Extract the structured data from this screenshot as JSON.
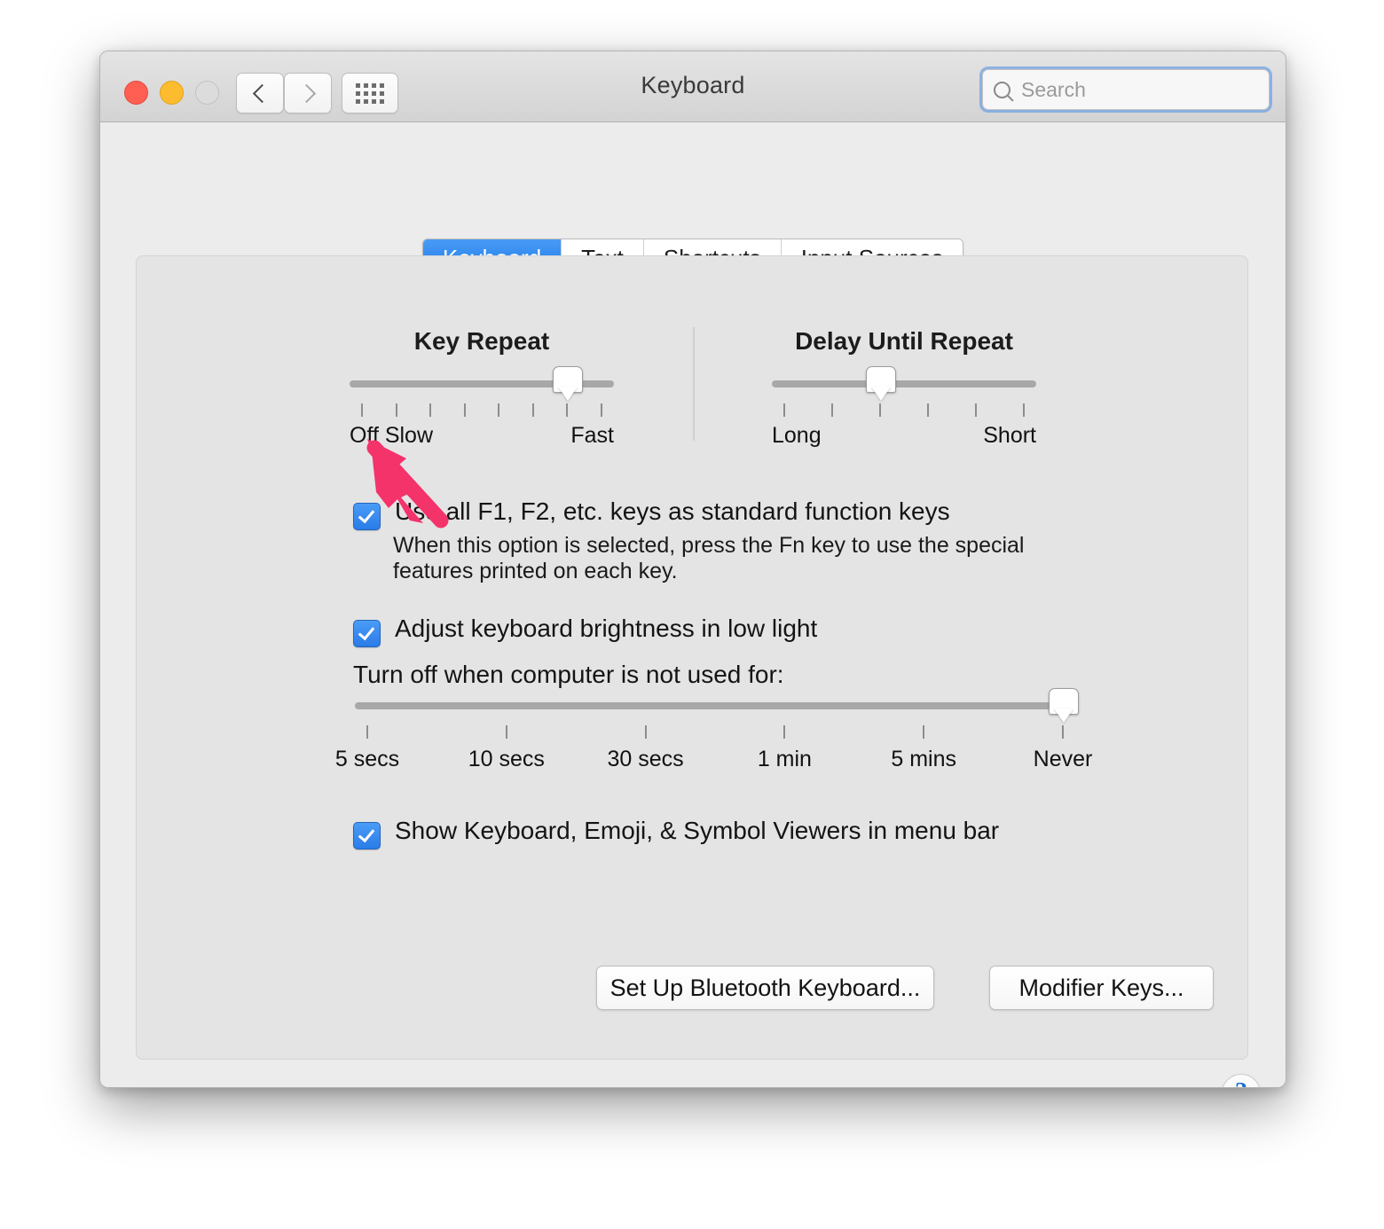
{
  "window": {
    "title": "Keyboard",
    "traffic_lights": {
      "close_label": "close",
      "minimize_label": "minimize",
      "zoom_label": "zoom"
    },
    "nav": {
      "back_icon": "chevron-left-icon",
      "forward_icon": "chevron-right-icon",
      "grid_icon": "show-all-grid-icon"
    }
  },
  "search": {
    "placeholder": "Search",
    "value": "",
    "icon": "search-icon"
  },
  "tabs": [
    {
      "label": "Keyboard",
      "active": true
    },
    {
      "label": "Text",
      "active": false
    },
    {
      "label": "Shortcuts",
      "active": false
    },
    {
      "label": "Input Sources",
      "active": false
    }
  ],
  "sliders": {
    "key_repeat": {
      "title": "Key Repeat",
      "left_label": "Off Slow",
      "right_label": "Fast",
      "tick_count": 8,
      "value_index": 6
    },
    "delay_until_repeat": {
      "title": "Delay Until Repeat",
      "left_label": "Long",
      "right_label": "Short",
      "tick_count": 6,
      "value_index": 2
    },
    "turn_off_after": {
      "label": "Turn off when computer is not used for:",
      "tick_labels": [
        "5 secs",
        "10 secs",
        "30 secs",
        "1 min",
        "5 mins",
        "Never"
      ],
      "value": "Never",
      "value_index": 5
    }
  },
  "checkboxes": {
    "function_keys": {
      "label": "Use all F1, F2, etc. keys as standard function keys",
      "checked": true,
      "description": "When this option is selected, press the Fn key to use the special\nfeatures printed on each key."
    },
    "brightness_low_light": {
      "label": "Adjust keyboard brightness in low light",
      "checked": true
    },
    "show_viewers": {
      "label": "Show Keyboard, Emoji, & Symbol Viewers in menu bar",
      "checked": true
    }
  },
  "buttons": {
    "bluetooth_keyboard": "Set Up Bluetooth Keyboard...",
    "modifier_keys": "Modifier Keys...",
    "help": "?"
  },
  "annotation": {
    "arrow_color": "#f4336b",
    "points_at": "function-keys-checkbox"
  },
  "colors": {
    "accent_blue": "#2a7ce8",
    "tab_active_blue": "#1878e8",
    "window_bg": "#ececec",
    "panel_bg": "#e4e4e4",
    "help_blue": "#1a6fd0",
    "arrow_pink": "#f4336b"
  }
}
